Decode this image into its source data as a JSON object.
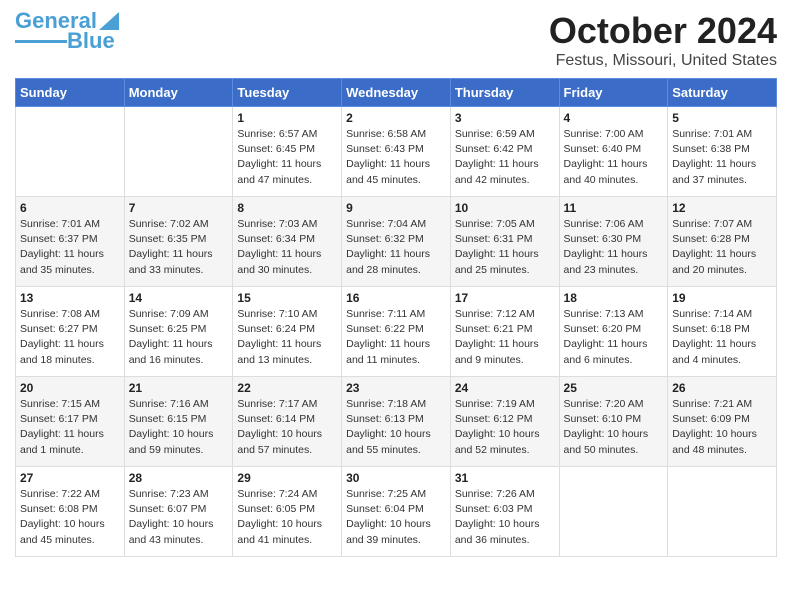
{
  "header": {
    "logo_line1": "General",
    "logo_line2": "Blue",
    "title": "October 2024",
    "subtitle": "Festus, Missouri, United States"
  },
  "days_of_week": [
    "Sunday",
    "Monday",
    "Tuesday",
    "Wednesday",
    "Thursday",
    "Friday",
    "Saturday"
  ],
  "weeks": [
    [
      {
        "num": "",
        "info": ""
      },
      {
        "num": "",
        "info": ""
      },
      {
        "num": "1",
        "info": "Sunrise: 6:57 AM\nSunset: 6:45 PM\nDaylight: 11 hours and 47 minutes."
      },
      {
        "num": "2",
        "info": "Sunrise: 6:58 AM\nSunset: 6:43 PM\nDaylight: 11 hours and 45 minutes."
      },
      {
        "num": "3",
        "info": "Sunrise: 6:59 AM\nSunset: 6:42 PM\nDaylight: 11 hours and 42 minutes."
      },
      {
        "num": "4",
        "info": "Sunrise: 7:00 AM\nSunset: 6:40 PM\nDaylight: 11 hours and 40 minutes."
      },
      {
        "num": "5",
        "info": "Sunrise: 7:01 AM\nSunset: 6:38 PM\nDaylight: 11 hours and 37 minutes."
      }
    ],
    [
      {
        "num": "6",
        "info": "Sunrise: 7:01 AM\nSunset: 6:37 PM\nDaylight: 11 hours and 35 minutes."
      },
      {
        "num": "7",
        "info": "Sunrise: 7:02 AM\nSunset: 6:35 PM\nDaylight: 11 hours and 33 minutes."
      },
      {
        "num": "8",
        "info": "Sunrise: 7:03 AM\nSunset: 6:34 PM\nDaylight: 11 hours and 30 minutes."
      },
      {
        "num": "9",
        "info": "Sunrise: 7:04 AM\nSunset: 6:32 PM\nDaylight: 11 hours and 28 minutes."
      },
      {
        "num": "10",
        "info": "Sunrise: 7:05 AM\nSunset: 6:31 PM\nDaylight: 11 hours and 25 minutes."
      },
      {
        "num": "11",
        "info": "Sunrise: 7:06 AM\nSunset: 6:30 PM\nDaylight: 11 hours and 23 minutes."
      },
      {
        "num": "12",
        "info": "Sunrise: 7:07 AM\nSunset: 6:28 PM\nDaylight: 11 hours and 20 minutes."
      }
    ],
    [
      {
        "num": "13",
        "info": "Sunrise: 7:08 AM\nSunset: 6:27 PM\nDaylight: 11 hours and 18 minutes."
      },
      {
        "num": "14",
        "info": "Sunrise: 7:09 AM\nSunset: 6:25 PM\nDaylight: 11 hours and 16 minutes."
      },
      {
        "num": "15",
        "info": "Sunrise: 7:10 AM\nSunset: 6:24 PM\nDaylight: 11 hours and 13 minutes."
      },
      {
        "num": "16",
        "info": "Sunrise: 7:11 AM\nSunset: 6:22 PM\nDaylight: 11 hours and 11 minutes."
      },
      {
        "num": "17",
        "info": "Sunrise: 7:12 AM\nSunset: 6:21 PM\nDaylight: 11 hours and 9 minutes."
      },
      {
        "num": "18",
        "info": "Sunrise: 7:13 AM\nSunset: 6:20 PM\nDaylight: 11 hours and 6 minutes."
      },
      {
        "num": "19",
        "info": "Sunrise: 7:14 AM\nSunset: 6:18 PM\nDaylight: 11 hours and 4 minutes."
      }
    ],
    [
      {
        "num": "20",
        "info": "Sunrise: 7:15 AM\nSunset: 6:17 PM\nDaylight: 11 hours and 1 minute."
      },
      {
        "num": "21",
        "info": "Sunrise: 7:16 AM\nSunset: 6:15 PM\nDaylight: 10 hours and 59 minutes."
      },
      {
        "num": "22",
        "info": "Sunrise: 7:17 AM\nSunset: 6:14 PM\nDaylight: 10 hours and 57 minutes."
      },
      {
        "num": "23",
        "info": "Sunrise: 7:18 AM\nSunset: 6:13 PM\nDaylight: 10 hours and 55 minutes."
      },
      {
        "num": "24",
        "info": "Sunrise: 7:19 AM\nSunset: 6:12 PM\nDaylight: 10 hours and 52 minutes."
      },
      {
        "num": "25",
        "info": "Sunrise: 7:20 AM\nSunset: 6:10 PM\nDaylight: 10 hours and 50 minutes."
      },
      {
        "num": "26",
        "info": "Sunrise: 7:21 AM\nSunset: 6:09 PM\nDaylight: 10 hours and 48 minutes."
      }
    ],
    [
      {
        "num": "27",
        "info": "Sunrise: 7:22 AM\nSunset: 6:08 PM\nDaylight: 10 hours and 45 minutes."
      },
      {
        "num": "28",
        "info": "Sunrise: 7:23 AM\nSunset: 6:07 PM\nDaylight: 10 hours and 43 minutes."
      },
      {
        "num": "29",
        "info": "Sunrise: 7:24 AM\nSunset: 6:05 PM\nDaylight: 10 hours and 41 minutes."
      },
      {
        "num": "30",
        "info": "Sunrise: 7:25 AM\nSunset: 6:04 PM\nDaylight: 10 hours and 39 minutes."
      },
      {
        "num": "31",
        "info": "Sunrise: 7:26 AM\nSunset: 6:03 PM\nDaylight: 10 hours and 36 minutes."
      },
      {
        "num": "",
        "info": ""
      },
      {
        "num": "",
        "info": ""
      }
    ]
  ]
}
